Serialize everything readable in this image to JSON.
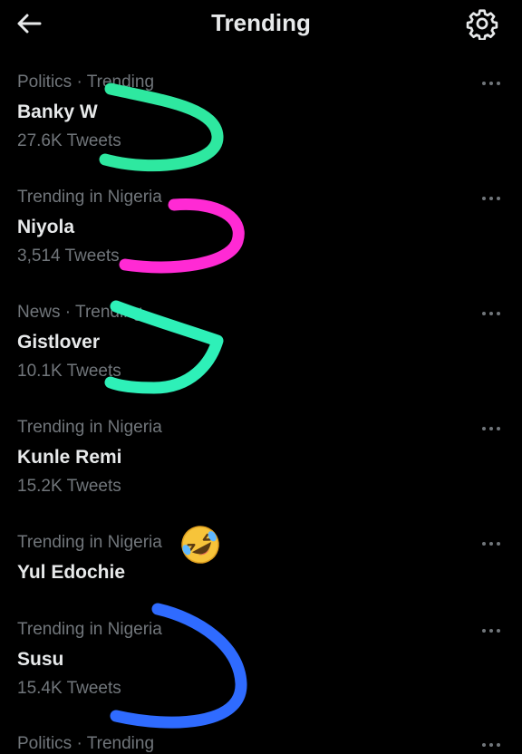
{
  "header": {
    "title": "Trending",
    "back_icon": "arrow-left-icon",
    "settings_icon": "gear-icon"
  },
  "trends": [
    {
      "category": "Politics · Trending",
      "name": "Banky W",
      "count": "27.6K Tweets"
    },
    {
      "category": "Trending in Nigeria",
      "name": "Niyola",
      "count": "3,514 Tweets"
    },
    {
      "category": "News · Trending",
      "name": "Gistlover",
      "count": "10.1K Tweets"
    },
    {
      "category": "Trending in Nigeria",
      "name": "Kunle Remi",
      "count": "15.2K Tweets"
    },
    {
      "category": "Trending in Nigeria",
      "name": "Yul Edochie",
      "count": ""
    },
    {
      "category": "Trending in Nigeria",
      "name": "Susu",
      "count": "15.4K Tweets"
    },
    {
      "category": "Politics · Trending",
      "name": "",
      "count": ""
    }
  ],
  "annotations": {
    "green_scribble": "#2ee8a0",
    "pink_scribble": "#ff2ad4",
    "teal_scribble": "#2ef0b8",
    "blue_scribble": "#2f6bff",
    "emoji": "rolling-on-floor-laughing-emoji"
  },
  "colors": {
    "background": "#000000",
    "primary_text": "#e7e9ea",
    "secondary_text": "#71767b"
  }
}
